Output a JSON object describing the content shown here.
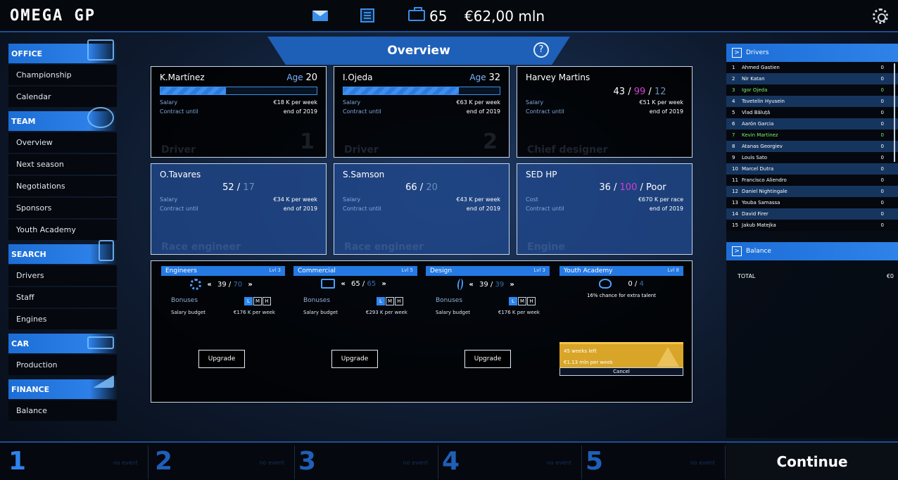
{
  "header": {
    "logo": "OMEGA GP",
    "staff_count": "65",
    "money": "€62,00 mln"
  },
  "sidebar": {
    "office": {
      "title": "OFFICE",
      "items": [
        "Championship",
        "Calendar"
      ]
    },
    "team": {
      "title": "TEAM",
      "items": [
        "Overview",
        "Next season",
        "Negotiations",
        "Sponsors",
        "Youth Academy"
      ]
    },
    "search": {
      "title": "SEARCH",
      "items": [
        "Drivers",
        "Staff",
        "Engines"
      ]
    },
    "car": {
      "title": "CAR",
      "items": [
        "Production"
      ]
    },
    "finance": {
      "title": "FINANCE",
      "items": [
        "Balance"
      ]
    }
  },
  "main": {
    "tab_title": "Overview",
    "help": "?",
    "cards": [
      {
        "name": "K.Martínez",
        "age_label": "Age",
        "age": "20",
        "progress": 0.42,
        "salary_label": "Salary",
        "salary": "€18 K per week",
        "contract_label": "Contract until",
        "contract": "end of 2019",
        "role": "Driver",
        "num": "1"
      },
      {
        "name": "I.Ojeda",
        "age_label": "Age",
        "age": "32",
        "progress": 0.74,
        "salary_label": "Salary",
        "salary": "€63 K per week",
        "contract_label": "Contract until",
        "contract": "end of 2019",
        "role": "Driver",
        "num": "2"
      },
      {
        "name": "Harvey Martins",
        "r1": "43",
        "r2": "99",
        "r3": "12",
        "salary_label": "Salary",
        "salary": "€51 K per week",
        "contract_label": "Contract until",
        "contract": "end of 2019",
        "role": "Chief designer"
      },
      {
        "name": "O.Tavares",
        "r1": "52",
        "r2": "17",
        "salary_label": "Salary",
        "salary": "€34 K per week",
        "contract_label": "Contract until",
        "contract": "end of 2019",
        "role": "Race engineer"
      },
      {
        "name": "S.Samson",
        "r1": "66",
        "r2": "20",
        "salary_label": "Salary",
        "salary": "€43 K per week",
        "contract_label": "Contract until",
        "contract": "end of 2019",
        "role": "Race engineer"
      },
      {
        "name": "SED HP",
        "r1": "36",
        "r2": "100",
        "r3": "Poor",
        "salary_label": "Cost",
        "salary": "€670 K per race",
        "contract_label": "Contract until",
        "contract": "end of 2019",
        "role": "Engine"
      }
    ],
    "facilities": [
      {
        "title": "Engineers",
        "lvl": "Lvl 3",
        "value": "39",
        "max": "70",
        "bonus_label": "Bonuses",
        "budget_label": "Salary budget",
        "budget": "€176 K per week",
        "upgrade": "Upgrade"
      },
      {
        "title": "Commercial",
        "lvl": "Lvl 5",
        "value": "65",
        "max": "65",
        "bonus_label": "Bonuses",
        "budget_label": "Salary budget",
        "budget": "€293 K per week",
        "upgrade": "Upgrade"
      },
      {
        "title": "Design",
        "lvl": "Lvl 3",
        "value": "39",
        "max": "39",
        "bonus_label": "Bonuses",
        "budget_label": "Salary budget",
        "budget": "€176 K per week",
        "upgrade": "Upgrade"
      },
      {
        "title": "Youth Academy",
        "lvl": "Lvl 8",
        "value": "0",
        "max": "4",
        "chance": "16% chance for extra talent",
        "weeks": "45 weeks left",
        "cost": "€1.13 mln per week",
        "cancel": "Cancel"
      }
    ],
    "lmh": [
      "L",
      "M",
      "H"
    ]
  },
  "drivers": {
    "title": "Drivers",
    "rows": [
      {
        "pos": "1",
        "name": "Ahmed Gastien",
        "pts": "0"
      },
      {
        "pos": "2",
        "name": "Nir Katan",
        "pts": "0"
      },
      {
        "pos": "3",
        "name": "Igor Ojeda",
        "pts": "0"
      },
      {
        "pos": "4",
        "name": "Tsvetelin Hyusein",
        "pts": "0"
      },
      {
        "pos": "5",
        "name": "Vlad Băluță",
        "pts": "0"
      },
      {
        "pos": "6",
        "name": "Aarón Garcia",
        "pts": "0"
      },
      {
        "pos": "7",
        "name": "Kevin Martinez",
        "pts": "0"
      },
      {
        "pos": "8",
        "name": "Atanas Georgiev",
        "pts": "0"
      },
      {
        "pos": "9",
        "name": "Louis Sato",
        "pts": "0"
      },
      {
        "pos": "10",
        "name": "Marcel Dutra",
        "pts": "0"
      },
      {
        "pos": "11",
        "name": "Francisco Aliendro",
        "pts": "0"
      },
      {
        "pos": "12",
        "name": "Daniel Nightingale",
        "pts": "0"
      },
      {
        "pos": "13",
        "name": "Youba Samassa",
        "pts": "0"
      },
      {
        "pos": "14",
        "name": "David Firer",
        "pts": "0"
      },
      {
        "pos": "15",
        "name": "Jakub Matejka",
        "pts": "0"
      }
    ]
  },
  "balance": {
    "title": "Balance",
    "total_label": "TOTAL",
    "total": "€0"
  },
  "footer": {
    "slots": [
      {
        "n": "1",
        "ev": "no event"
      },
      {
        "n": "2",
        "ev": "no event"
      },
      {
        "n": "3",
        "ev": "no event"
      },
      {
        "n": "4",
        "ev": "no event"
      },
      {
        "n": "5",
        "ev": "no event"
      }
    ],
    "continue": "Continue"
  }
}
